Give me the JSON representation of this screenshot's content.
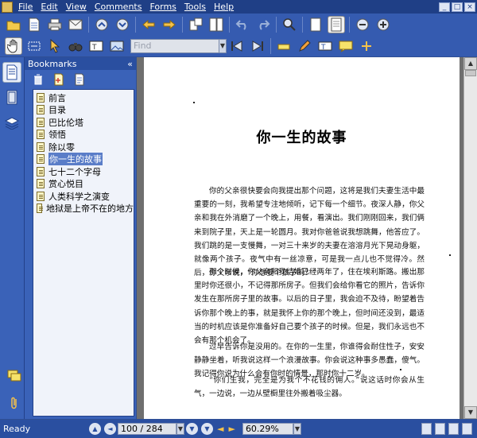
{
  "menu": [
    "File",
    "Edit",
    "View",
    "Comments",
    "Forms",
    "Tools",
    "Help"
  ],
  "window_buttons": [
    "_",
    "□",
    "×"
  ],
  "find": {
    "placeholder": "Find"
  },
  "bookmarks_panel": {
    "title": "Bookmarks",
    "collapse_glyph": "«",
    "items": [
      {
        "label": "前言",
        "selected": false
      },
      {
        "label": "目录",
        "selected": false
      },
      {
        "label": "巴比伦塔",
        "selected": false
      },
      {
        "label": "领悟",
        "selected": false
      },
      {
        "label": "除以零",
        "selected": false
      },
      {
        "label": "你一生的故事",
        "selected": true
      },
      {
        "label": "七十二个字母",
        "selected": false
      },
      {
        "label": "赏心悦目",
        "selected": false
      },
      {
        "label": "人类科学之演变",
        "selected": false
      },
      {
        "label": "地狱是上帝不在的地方",
        "selected": false
      }
    ]
  },
  "page": {
    "title": "你一生的故事",
    "paragraphs": [
      "你的父亲很快要会向我提出那个问题，这将是我们夫妻生活中最重要的一刻，我希望专注地倾听，记下每一个细节。夜深人静，你父亲和我在外消磨了一个晚上，用餐，看演出。我们刚刚回来，我们俩来到院子里，天上是一轮圆月。我对你爸爸说我想跳舞，他答应了。我们跳的是一支慢舞，一对三十来岁的夫妻在溶溶月光下晃动身躯，就像两个孩子。夜气中有一丝凉意，可是我一点儿也不觉得冷。然后，你父亲说，“你想要个孩子吗？”",
      "那个时候，你父亲和我结婚已经两年了，住在埃利斯路。搬出那里时你还很小，不记得那所房子。但我们会给你看它的照片，告诉你发生在那所房子里的故事。以后的日子里，我会迫不及待，盼望着告诉你那个晚上的事，就是我怀上你的那个晚上，但时间还没到，最适当的时机应该是你准备好自己要个孩子的时候。但是，我们永远也不会有那个机会了。",
      "过早告诉你是没用的。在你的一生里，你谁得会耐住性子，安安静静坐着，听我说这样一个浪漫故事。你会说这种事多愚蠢，傻气。我记得你说为什么会有你时的情景，那时你十二岁。",
      "“你们生我，完全是为我个不花钱的佣人。”说这话时你会从生气，一边说，一边从壁橱里往外搬着吸尘器。"
    ]
  },
  "status": {
    "text": "Ready",
    "page_indicator": "100 / 284",
    "zoom": "60.29%"
  },
  "colors": {
    "chrome": "#2f4f94",
    "toolbar": "#355bb0",
    "selection": "#5a7dc8",
    "doc_background": "#6f6f6f"
  }
}
